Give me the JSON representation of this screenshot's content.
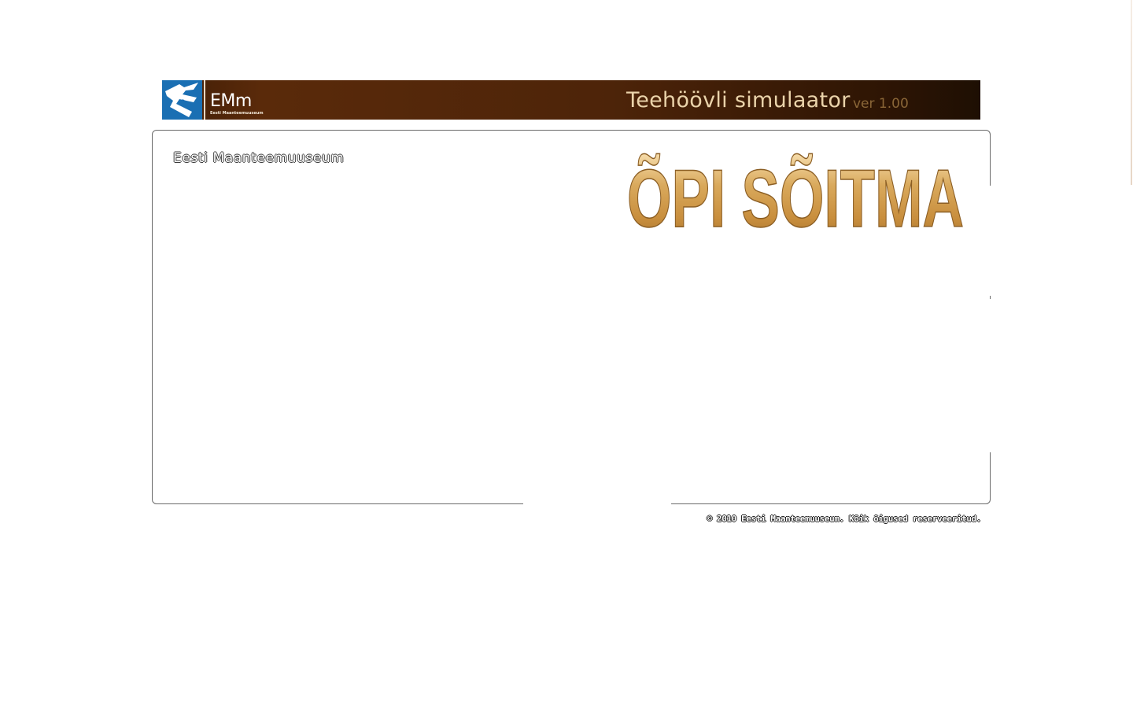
{
  "header": {
    "logo_mark": "EMm",
    "logo_subtitle": "Eesti Maanteemuuseum",
    "logo_icon": "road-bird-logo-icon",
    "title": "Teehöövli simulaator",
    "version": "ver 1.00"
  },
  "panel": {
    "museum_label": "Eesti Maanteemuuseum",
    "banner_text": "ÕPI SÕITMA"
  },
  "footer": {
    "copyright": "© 2010 Eesti Maanteemuuseum. Kõik õigused reserveeritud."
  },
  "colors": {
    "header_dark": "#2e1504",
    "header_warm": "#5a2a0a",
    "logo_blue": "#1a6fb3",
    "title_gold": "#ead3aa",
    "version_gold": "#8a6637",
    "banner_gold": "#c98f3e"
  }
}
